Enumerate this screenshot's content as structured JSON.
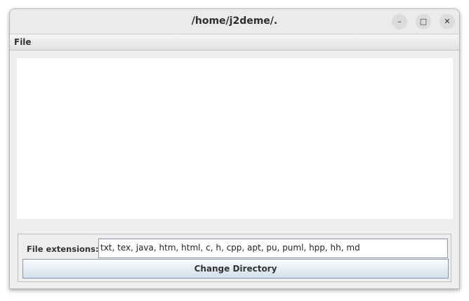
{
  "window": {
    "title": "/home/j2deme/.",
    "minimize_icon": "minimize-icon",
    "maximize_icon": "maximize-icon",
    "close_icon": "close-icon"
  },
  "menubar": {
    "items": [
      {
        "label": "File"
      }
    ]
  },
  "form": {
    "extensions_label": "File extensions:",
    "extensions_value": "txt, tex, java, htm, html, c, h, cpp, apt, pu, puml, hpp, hh, md",
    "change_dir_label": "Change Directory"
  }
}
